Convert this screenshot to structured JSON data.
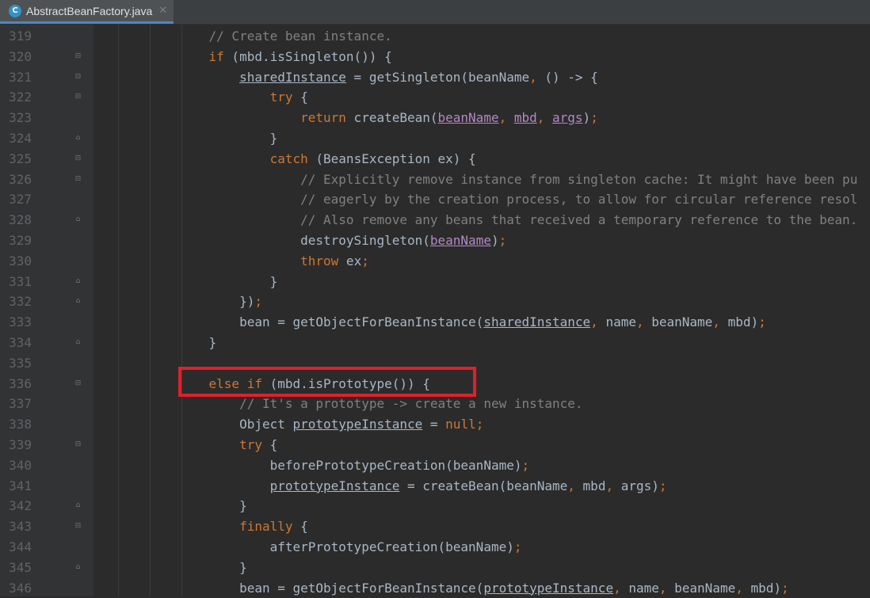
{
  "tab": {
    "title": "AbstractBeanFactory.java",
    "icon": "java-class-icon",
    "close": "✕"
  },
  "colors": {
    "background": "#2b2b2b",
    "keyword": "#cc7832",
    "comment": "#808080",
    "text": "#a9b7c6",
    "param": "#b389c5",
    "highlight": "#e0202a"
  },
  "lines": [
    {
      "n": "319",
      "fold": "",
      "code": [
        [
          "cm",
          "    // Create bean instance."
        ]
      ]
    },
    {
      "n": "320",
      "fold": "open",
      "code": [
        [
          "t",
          "    "
        ],
        [
          "kw",
          "if"
        ],
        [
          "t",
          " (mbd.isSingleton()) {"
        ]
      ]
    },
    {
      "n": "321",
      "fold": "open",
      "code": [
        [
          "t",
          "        "
        ],
        [
          "un",
          "sharedInstance"
        ],
        [
          "t",
          " = getSingleton(beanName"
        ],
        [
          "kw",
          ","
        ],
        [
          "t",
          " () -> {"
        ]
      ]
    },
    {
      "n": "322",
      "fold": "open",
      "code": [
        [
          "t",
          "            "
        ],
        [
          "kw",
          "try"
        ],
        [
          "t",
          " {"
        ]
      ]
    },
    {
      "n": "323",
      "fold": "",
      "code": [
        [
          "t",
          "                "
        ],
        [
          "kw",
          "return"
        ],
        [
          "t",
          " createBean("
        ],
        [
          "pu",
          "beanName"
        ],
        [
          "kw",
          ", "
        ],
        [
          "pu",
          "mbd"
        ],
        [
          "kw",
          ", "
        ],
        [
          "pu",
          "args"
        ],
        [
          "t",
          ")"
        ],
        [
          "kw",
          ";"
        ]
      ]
    },
    {
      "n": "324",
      "fold": "close",
      "code": [
        [
          "t",
          "            }"
        ]
      ]
    },
    {
      "n": "325",
      "fold": "open",
      "code": [
        [
          "t",
          "            "
        ],
        [
          "kw",
          "catch"
        ],
        [
          "t",
          " (BeansException ex) {"
        ]
      ]
    },
    {
      "n": "326",
      "fold": "open",
      "code": [
        [
          "cm",
          "                // Explicitly remove instance from singleton cache: It might have been pu"
        ]
      ]
    },
    {
      "n": "327",
      "fold": "",
      "code": [
        [
          "cm",
          "                // eagerly by the creation process, to allow for circular reference resol"
        ]
      ]
    },
    {
      "n": "328",
      "fold": "close",
      "code": [
        [
          "cm",
          "                // Also remove any beans that received a temporary reference to the bean."
        ]
      ]
    },
    {
      "n": "329",
      "fold": "",
      "code": [
        [
          "t",
          "                destroySingleton("
        ],
        [
          "pu",
          "beanName"
        ],
        [
          "t",
          ")"
        ],
        [
          "kw",
          ";"
        ]
      ]
    },
    {
      "n": "330",
      "fold": "",
      "code": [
        [
          "t",
          "                "
        ],
        [
          "kw",
          "throw"
        ],
        [
          "t",
          " ex"
        ],
        [
          "kw",
          ";"
        ]
      ]
    },
    {
      "n": "331",
      "fold": "close",
      "code": [
        [
          "t",
          "            }"
        ]
      ]
    },
    {
      "n": "332",
      "fold": "close",
      "code": [
        [
          "t",
          "        })"
        ],
        [
          "kw",
          ";"
        ]
      ]
    },
    {
      "n": "333",
      "fold": "",
      "code": [
        [
          "t",
          "        bean = getObjectForBeanInstance("
        ],
        [
          "un",
          "sharedInstance"
        ],
        [
          "kw",
          ", "
        ],
        [
          "t",
          "name"
        ],
        [
          "kw",
          ", "
        ],
        [
          "t",
          "beanName"
        ],
        [
          "kw",
          ", "
        ],
        [
          "t",
          "mbd)"
        ],
        [
          "kw",
          ";"
        ]
      ]
    },
    {
      "n": "334",
      "fold": "close",
      "code": [
        [
          "t",
          "    }"
        ]
      ]
    },
    {
      "n": "335",
      "fold": "",
      "code": []
    },
    {
      "n": "336",
      "fold": "open",
      "code": [
        [
          "t",
          "    "
        ],
        [
          "kw",
          "else if"
        ],
        [
          "t",
          " (mbd.isPrototype()) {"
        ]
      ]
    },
    {
      "n": "337",
      "fold": "",
      "code": [
        [
          "cm",
          "        // It's a prototype -> create a new instance."
        ]
      ]
    },
    {
      "n": "338",
      "fold": "",
      "code": [
        [
          "t",
          "        Object "
        ],
        [
          "un",
          "prototypeInstance"
        ],
        [
          "t",
          " = "
        ],
        [
          "kw",
          "null;"
        ]
      ]
    },
    {
      "n": "339",
      "fold": "open",
      "code": [
        [
          "t",
          "        "
        ],
        [
          "kw",
          "try"
        ],
        [
          "t",
          " {"
        ]
      ]
    },
    {
      "n": "340",
      "fold": "",
      "code": [
        [
          "t",
          "            beforePrototypeCreation(beanName)"
        ],
        [
          "kw",
          ";"
        ]
      ]
    },
    {
      "n": "341",
      "fold": "",
      "code": [
        [
          "t",
          "            "
        ],
        [
          "un",
          "prototypeInstance"
        ],
        [
          "t",
          " = createBean(beanName"
        ],
        [
          "kw",
          ", "
        ],
        [
          "t",
          "mbd"
        ],
        [
          "kw",
          ", "
        ],
        [
          "t",
          "args)"
        ],
        [
          "kw",
          ";"
        ]
      ]
    },
    {
      "n": "342",
      "fold": "close",
      "code": [
        [
          "t",
          "        }"
        ]
      ]
    },
    {
      "n": "343",
      "fold": "open",
      "code": [
        [
          "t",
          "        "
        ],
        [
          "kw",
          "finally"
        ],
        [
          "t",
          " {"
        ]
      ]
    },
    {
      "n": "344",
      "fold": "",
      "code": [
        [
          "t",
          "            afterPrototypeCreation(beanName)"
        ],
        [
          "kw",
          ";"
        ]
      ]
    },
    {
      "n": "345",
      "fold": "close",
      "code": [
        [
          "t",
          "        }"
        ]
      ]
    },
    {
      "n": "346",
      "fold": "",
      "code": [
        [
          "t",
          "        bean = getObjectForBeanInstance("
        ],
        [
          "un",
          "prototypeInstance"
        ],
        [
          "kw",
          ", "
        ],
        [
          "t",
          "name"
        ],
        [
          "kw",
          ", "
        ],
        [
          "t",
          "beanName"
        ],
        [
          "kw",
          ", "
        ],
        [
          "t",
          "mbd)"
        ],
        [
          "kw",
          ";"
        ]
      ]
    }
  ]
}
